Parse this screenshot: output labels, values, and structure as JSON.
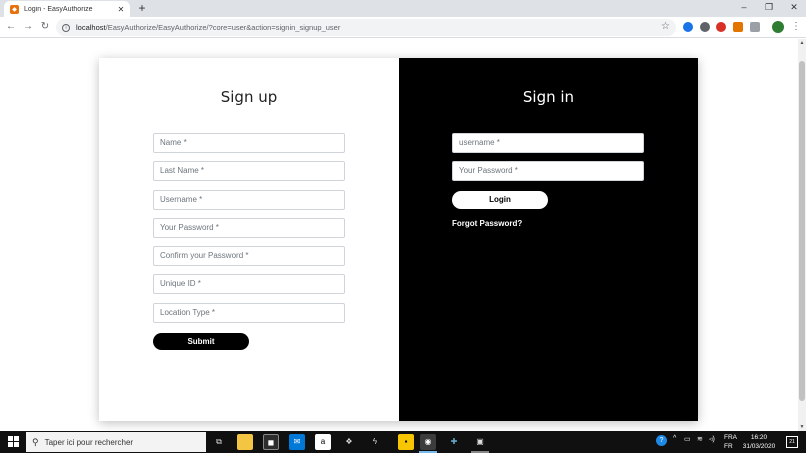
{
  "browser": {
    "tab_title": "Login - EasyAuthorize",
    "tab_close": "✕",
    "new_tab": "+",
    "url_host": "localhost",
    "url_path": "/EasyAuthorize/EasyAuthorize/?core=user&action=signin_signup_user",
    "window_controls": {
      "minimize": "–",
      "maximize": "❐",
      "close": "✕"
    },
    "icons": [
      "back-arrow-icon",
      "forward-arrow-icon",
      "reload-icon",
      "info-icon",
      "star-icon"
    ]
  },
  "signup": {
    "title": "Sign up",
    "fields": [
      {
        "placeholder": "Name *"
      },
      {
        "placeholder": "Last Name *"
      },
      {
        "placeholder": "Username *"
      },
      {
        "placeholder": "Your Password *"
      },
      {
        "placeholder": "Confirm your Password *"
      },
      {
        "placeholder": "Unique ID *"
      },
      {
        "placeholder": "Location Type *"
      }
    ],
    "submit_label": "Submit"
  },
  "signin": {
    "title": "Sign in",
    "username_placeholder": "username *",
    "password_placeholder": "Your Password *",
    "login_label": "Login",
    "forgot_label": "Forgot Password?"
  },
  "taskbar": {
    "search_placeholder": "Taper ici pour rechercher",
    "lang_top": "FRA",
    "lang_bottom": "FR",
    "time": "16:20",
    "date": "31/03/2020",
    "notifications": "21"
  },
  "colors": {
    "signin_bg": "#000000",
    "signup_bg": "#ffffff",
    "button_dark": "#000000",
    "button_light": "#ffffff"
  }
}
